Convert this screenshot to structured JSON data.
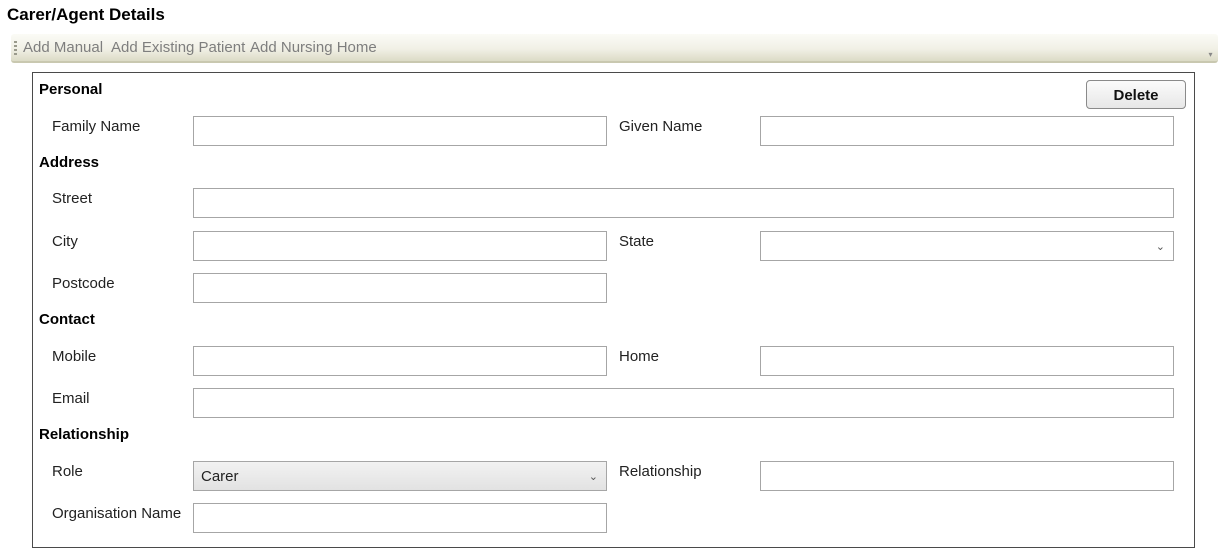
{
  "page": {
    "title": "Carer/Agent Details"
  },
  "toolbar": {
    "add_manual": "Add Manual",
    "add_existing_patient": "Add Existing Patient",
    "add_nursing_home": "Add Nursing Home",
    "overflow_icon": "chevron-down-icon"
  },
  "actions": {
    "delete_label": "Delete"
  },
  "sections": {
    "personal": "Personal",
    "address": "Address",
    "contact": "Contact",
    "relationship": "Relationship"
  },
  "fields": {
    "family_name": {
      "label": "Family Name",
      "value": ""
    },
    "given_name": {
      "label": "Given Name",
      "value": ""
    },
    "street": {
      "label": "Street",
      "value": ""
    },
    "city": {
      "label": "City",
      "value": ""
    },
    "state": {
      "label": "State",
      "value": ""
    },
    "postcode": {
      "label": "Postcode",
      "value": ""
    },
    "mobile": {
      "label": "Mobile",
      "value": ""
    },
    "home": {
      "label": "Home",
      "value": ""
    },
    "email": {
      "label": "Email",
      "value": ""
    },
    "role": {
      "label": "Role",
      "value": "Carer"
    },
    "relationship": {
      "label": "Relationship",
      "value": ""
    },
    "organisation_name": {
      "label": "Organisation Name",
      "value": ""
    }
  },
  "colors": {
    "toolbar_text": "#7e7e7e",
    "panel_border": "#4a4a4a",
    "field_border": "#a6a6a6"
  }
}
